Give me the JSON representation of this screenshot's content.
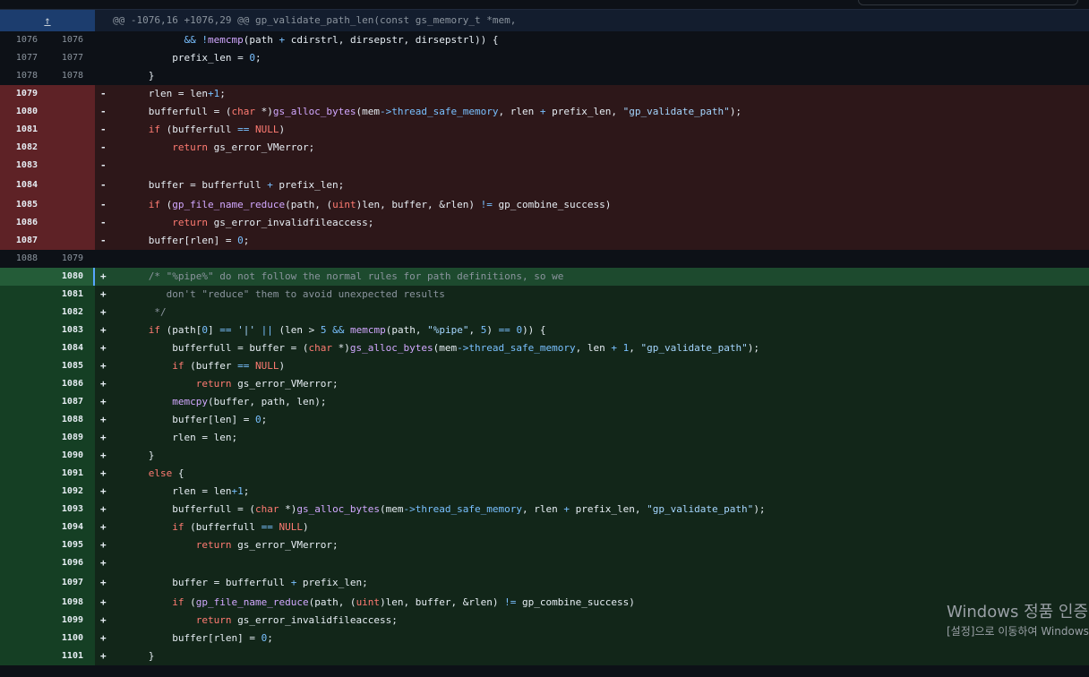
{
  "hunk_header": "@@ -1076,16 +1076,29 @@ gp_validate_path_len(const gs_memory_t *mem,",
  "expand_icon": "expand-up-icon",
  "colors": {
    "deleted_gutter": "#5e2226",
    "deleted_line": "#2d1719",
    "added_gutter": "#153f24",
    "added_line": "#122619",
    "hunk_expand": "#1c3d6e"
  },
  "lines": [
    {
      "type": "ctx",
      "old": "1076",
      "new": "1076",
      "sign": "",
      "code": "            && !memcmp(path + cdirstrl, dirsepstr, dirsepstrl)) {"
    },
    {
      "type": "ctx",
      "old": "1077",
      "new": "1077",
      "sign": "",
      "code": "          prefix_len = 0;"
    },
    {
      "type": "ctx",
      "old": "1078",
      "new": "1078",
      "sign": "",
      "code": "      }"
    },
    {
      "type": "del",
      "old": "1079",
      "new": "",
      "sign": "-",
      "code": "      rlen = len+1;"
    },
    {
      "type": "del",
      "old": "1080",
      "new": "",
      "sign": "-",
      "code": "      bufferfull = (char *)gs_alloc_bytes(mem->thread_safe_memory, rlen + prefix_len, \"gp_validate_path\");"
    },
    {
      "type": "del",
      "old": "1081",
      "new": "",
      "sign": "-",
      "code": "      if (bufferfull == NULL)"
    },
    {
      "type": "del",
      "old": "1082",
      "new": "",
      "sign": "-",
      "code": "          return gs_error_VMerror;"
    },
    {
      "type": "del",
      "old": "1083",
      "new": "",
      "sign": "-",
      "code": ""
    },
    {
      "type": "del",
      "old": "1084",
      "new": "",
      "sign": "-",
      "code": "      buffer = bufferfull + prefix_len;"
    },
    {
      "type": "del",
      "old": "1085",
      "new": "",
      "sign": "-",
      "code": "      if (gp_file_name_reduce(path, (uint)len, buffer, &rlen) != gp_combine_success)"
    },
    {
      "type": "del",
      "old": "1086",
      "new": "",
      "sign": "-",
      "code": "          return gs_error_invalidfileaccess;"
    },
    {
      "type": "del",
      "old": "1087",
      "new": "",
      "sign": "-",
      "code": "      buffer[rlen] = 0;"
    },
    {
      "type": "ctx",
      "old": "1088",
      "new": "1079",
      "sign": "",
      "code": ""
    },
    {
      "type": "add",
      "old": "",
      "new": "1080",
      "sign": "+",
      "code": "      /* \"%pipe%\" do not follow the normal rules for path definitions, so we"
    },
    {
      "type": "add",
      "old": "",
      "new": "1081",
      "sign": "+",
      "code": "         don't \"reduce\" them to avoid unexpected results"
    },
    {
      "type": "add",
      "old": "",
      "new": "1082",
      "sign": "+",
      "code": "       */"
    },
    {
      "type": "add",
      "old": "",
      "new": "1083",
      "sign": "+",
      "code": "      if (path[0] == '|' || (len > 5 && memcmp(path, \"%pipe\", 5) == 0)) {"
    },
    {
      "type": "add",
      "old": "",
      "new": "1084",
      "sign": "+",
      "code": "          bufferfull = buffer = (char *)gs_alloc_bytes(mem->thread_safe_memory, len + 1, \"gp_validate_path\");"
    },
    {
      "type": "add",
      "old": "",
      "new": "1085",
      "sign": "+",
      "code": "          if (buffer == NULL)"
    },
    {
      "type": "add",
      "old": "",
      "new": "1086",
      "sign": "+",
      "code": "              return gs_error_VMerror;"
    },
    {
      "type": "add",
      "old": "",
      "new": "1087",
      "sign": "+",
      "code": "          memcpy(buffer, path, len);"
    },
    {
      "type": "add",
      "old": "",
      "new": "1088",
      "sign": "+",
      "code": "          buffer[len] = 0;"
    },
    {
      "type": "add",
      "old": "",
      "new": "1089",
      "sign": "+",
      "code": "          rlen = len;"
    },
    {
      "type": "add",
      "old": "",
      "new": "1090",
      "sign": "+",
      "code": "      }"
    },
    {
      "type": "add",
      "old": "",
      "new": "1091",
      "sign": "+",
      "code": "      else {"
    },
    {
      "type": "add",
      "old": "",
      "new": "1092",
      "sign": "+",
      "code": "          rlen = len+1;"
    },
    {
      "type": "add",
      "old": "",
      "new": "1093",
      "sign": "+",
      "code": "          bufferfull = (char *)gs_alloc_bytes(mem->thread_safe_memory, rlen + prefix_len, \"gp_validate_path\");"
    },
    {
      "type": "add",
      "old": "",
      "new": "1094",
      "sign": "+",
      "code": "          if (bufferfull == NULL)"
    },
    {
      "type": "add",
      "old": "",
      "new": "1095",
      "sign": "+",
      "code": "              return gs_error_VMerror;"
    },
    {
      "type": "add",
      "old": "",
      "new": "1096",
      "sign": "+",
      "code": ""
    },
    {
      "type": "add",
      "old": "",
      "new": "1097",
      "sign": "+",
      "code": "          buffer = bufferfull + prefix_len;"
    },
    {
      "type": "add",
      "old": "",
      "new": "1098",
      "sign": "+",
      "code": "          if (gp_file_name_reduce(path, (uint)len, buffer, &rlen) != gp_combine_success)"
    },
    {
      "type": "add",
      "old": "",
      "new": "1099",
      "sign": "+",
      "code": "              return gs_error_invalidfileaccess;"
    },
    {
      "type": "add",
      "old": "",
      "new": "1100",
      "sign": "+",
      "code": "          buffer[rlen] = 0;"
    },
    {
      "type": "add",
      "old": "",
      "new": "1101",
      "sign": "+",
      "code": "      }"
    }
  ],
  "watermark": {
    "line1": "Windows 정품 인증",
    "line2": "[설정]으로 이동하여 Windows"
  }
}
